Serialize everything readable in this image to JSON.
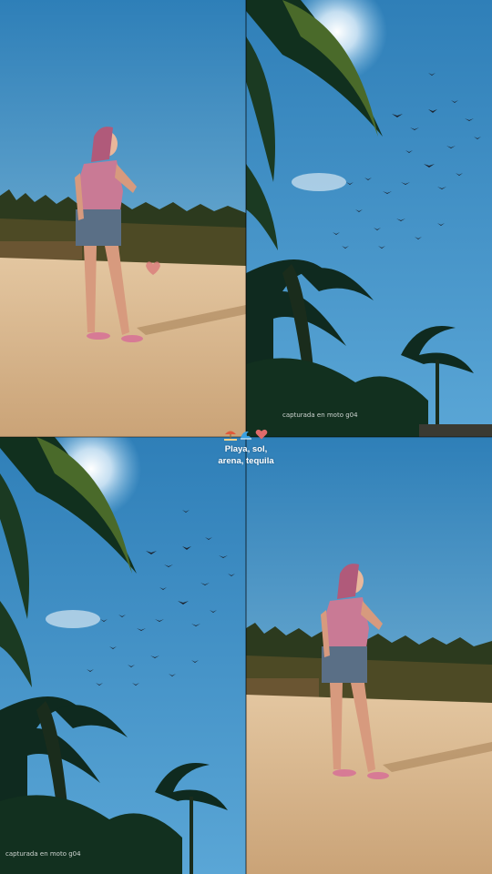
{
  "caption": {
    "line1": "Playa, sol,",
    "line2": "arena, tequila",
    "emoji_icons": [
      "beach-umbrella-icon",
      "wave-icon",
      "heart-icon"
    ]
  },
  "credits": {
    "top_right": "capturada en moto g04",
    "bottom_left": "capturada en moto g04"
  },
  "colors": {
    "sky": "#3b8fc4",
    "sand": "#d9b98f",
    "palm": "#0f2a1f"
  }
}
